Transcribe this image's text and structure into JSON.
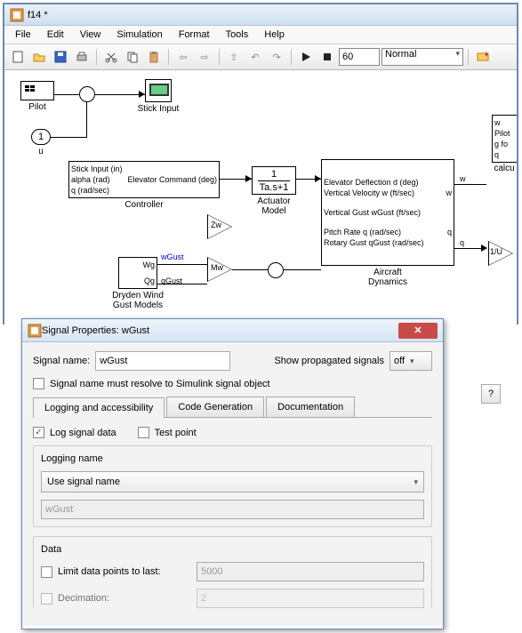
{
  "main_window": {
    "title": "f14 *",
    "menu": {
      "file": "File",
      "edit": "Edit",
      "view": "View",
      "simulation": "Simulation",
      "format": "Format",
      "tools": "Tools",
      "help": "Help"
    },
    "toolbar": {
      "stop_time": "60",
      "mode": "Normal"
    }
  },
  "blocks": {
    "pilot": {
      "name": "Pilot"
    },
    "u": {
      "name": "u",
      "num": "1"
    },
    "stick_input": {
      "name": "Stick Input"
    },
    "controller": {
      "name": "Controller",
      "in1": "Stick Input (in)",
      "in2": "alpha (rad)",
      "in3": "q (rad/sec)",
      "out": "Elevator Command (deg)"
    },
    "actuator": {
      "name": "Actuator\nModel",
      "tf": "1",
      "den": "Ta.s+1"
    },
    "aircraft": {
      "name": "Aircraft\nDynamics",
      "in1": "Elevator Deflection d (deg)",
      "in2": "Vertical Velocity w (ft/sec)",
      "in3": "Vertical Gust wGust (ft/sec)",
      "in4": "Pitch Rate q (rad/sec)",
      "in5": "Rotary Gust qGust (rad/sec)",
      "out1": "w",
      "out2": "q"
    },
    "dryden": {
      "name": "Dryden Wind\nGust Models",
      "p1": "Wg",
      "p2": "Qg",
      "sig1": "wGust",
      "sig2": "qGust"
    },
    "gain_zw": "Zw",
    "gain_mw": "Mw",
    "calc": {
      "p1": "w",
      "p2": "Pilot g fo",
      "p3": "q",
      "name": "calcu"
    },
    "gain_1u": "1/U"
  },
  "dialog": {
    "title": "Signal Properties: wGust",
    "signal_name_label": "Signal name:",
    "signal_name_value": "wGust",
    "propagated_label": "Show propagated signals",
    "propagated_value": "off",
    "resolve_label": "Signal name must resolve to Simulink signal object",
    "tabs": {
      "log": "Logging and accessibility",
      "code": "Code Generation",
      "doc": "Documentation"
    },
    "log_signal_label": "Log signal data",
    "test_point_label": "Test point",
    "logging_name_header": "Logging name",
    "logging_name_mode": "Use signal name",
    "logging_name_value": "wGust",
    "data_header": "Data",
    "limit_label": "Limit data points to last:",
    "limit_value": "5000",
    "decimation_label": "Decimation:",
    "decimation_value": "2"
  },
  "help_btn": "?"
}
